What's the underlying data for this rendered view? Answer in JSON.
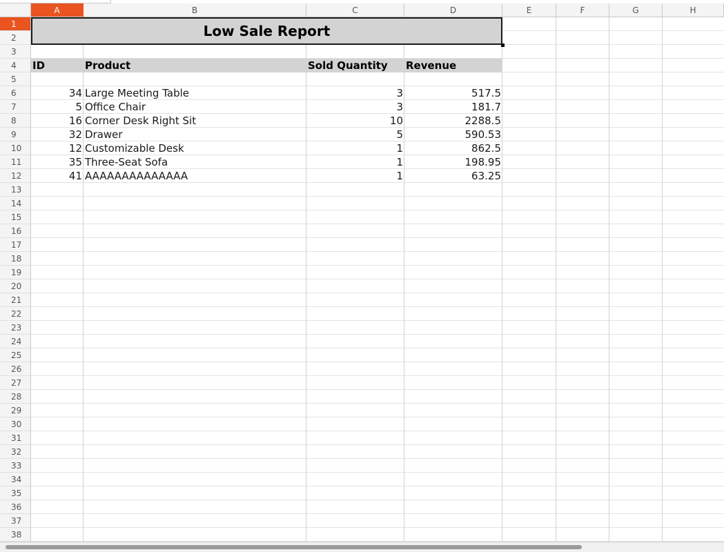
{
  "columns": [
    "A",
    "B",
    "C",
    "D",
    "E",
    "F",
    "G",
    "H"
  ],
  "rows": [
    "1",
    "2",
    "3",
    "4",
    "5",
    "6",
    "7",
    "8",
    "9",
    "10",
    "11",
    "12",
    "13",
    "14",
    "15",
    "16",
    "17",
    "18",
    "19",
    "20",
    "21",
    "22",
    "23",
    "24",
    "25",
    "26",
    "27",
    "28",
    "29",
    "30",
    "31",
    "32",
    "33",
    "34",
    "35",
    "36",
    "37",
    "38"
  ],
  "selected_cell": "A1",
  "colors": {
    "accent": "#e95420",
    "header_fill": "#d3d3d3"
  },
  "report": {
    "title": "Low Sale Report",
    "headers": {
      "id": "ID",
      "product": "Product",
      "qty": "Sold Quantity",
      "revenue": "Revenue"
    },
    "items": [
      {
        "id": "34",
        "product": "Large Meeting Table",
        "qty": "3",
        "revenue": "517.5"
      },
      {
        "id": "5",
        "product": "Office Chair",
        "qty": "3",
        "revenue": "181.7"
      },
      {
        "id": "16",
        "product": "Corner Desk Right Sit",
        "qty": "10",
        "revenue": "2288.5"
      },
      {
        "id": "32",
        "product": "Drawer",
        "qty": "5",
        "revenue": "590.53"
      },
      {
        "id": "12",
        "product": "Customizable Desk",
        "qty": "1",
        "revenue": "862.5"
      },
      {
        "id": "35",
        "product": "Three-Seat Sofa",
        "qty": "1",
        "revenue": "198.95"
      },
      {
        "id": "41",
        "product": "AAAAAAAAAAAAAA",
        "qty": "1",
        "revenue": "63.25"
      }
    ]
  }
}
